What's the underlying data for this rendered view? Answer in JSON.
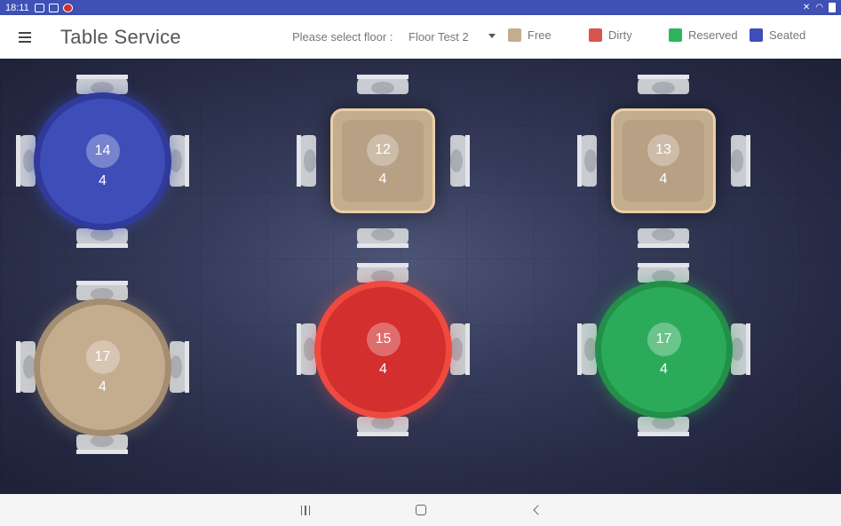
{
  "status_bar": {
    "time": "18:11"
  },
  "app_bar": {
    "title": "Table Service"
  },
  "floor_picker": {
    "label": "Please select floor :",
    "selected": "Floor Test 2"
  },
  "legend": [
    {
      "label": "Free",
      "color": "#c4ad8f"
    },
    {
      "label": "Dirty",
      "color": "#d9534f"
    },
    {
      "label": "Reserved",
      "color": "#2eb35e"
    },
    {
      "label": "Seated",
      "color": "#3f4db8"
    }
  ],
  "tables": [
    {
      "number": "14",
      "seats": "4",
      "shape": "round",
      "status": "Seated"
    },
    {
      "number": "12",
      "seats": "4",
      "shape": "square",
      "status": "Free"
    },
    {
      "number": "13",
      "seats": "4",
      "shape": "square",
      "status": "Free"
    },
    {
      "number": "17",
      "seats": "4",
      "shape": "round",
      "status": "Free"
    },
    {
      "number": "15",
      "seats": "4",
      "shape": "round",
      "status": "Dirty"
    },
    {
      "number": "17",
      "seats": "4",
      "shape": "round",
      "status": "Reserved"
    }
  ]
}
